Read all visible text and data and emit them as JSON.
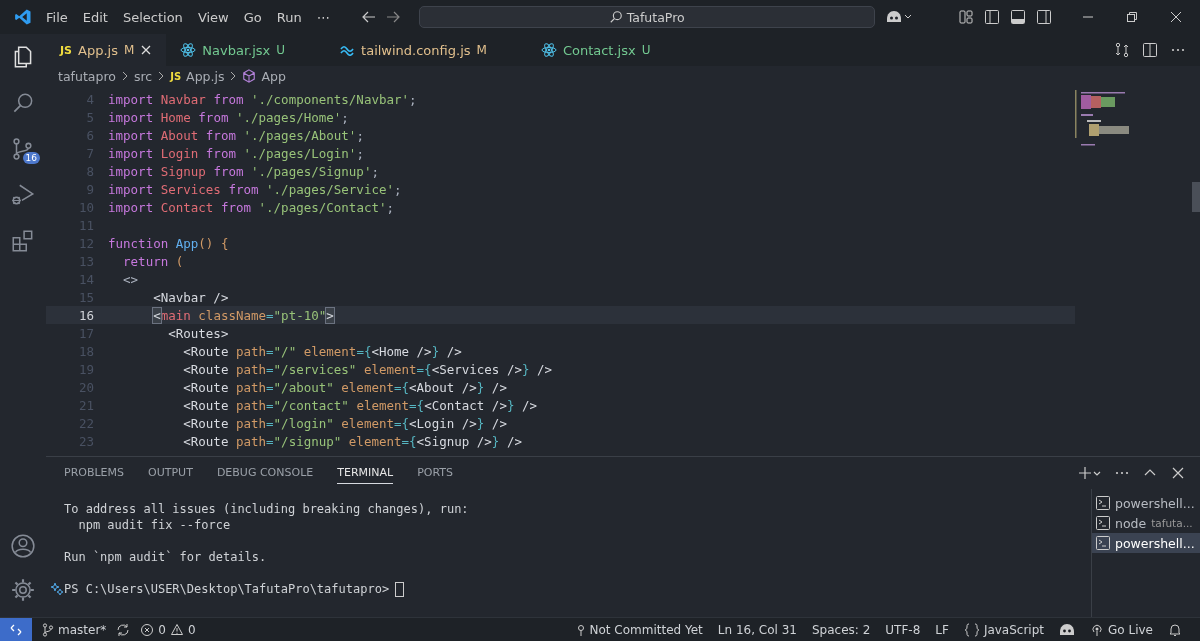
{
  "title_bar": {
    "menu": [
      "File",
      "Edit",
      "Selection",
      "View",
      "Go",
      "Run",
      "⋯"
    ],
    "search": {
      "value": "TafutaPro"
    }
  },
  "activity_bar": {
    "items": [
      {
        "kind": "explorer",
        "selected": true
      },
      {
        "kind": "search",
        "selected": false
      },
      {
        "kind": "source-control",
        "selected": false,
        "badge": "16"
      },
      {
        "kind": "run",
        "selected": false
      },
      {
        "kind": "extensions",
        "selected": false
      }
    ]
  },
  "tabs": [
    {
      "kind": "script",
      "type_label": "JS",
      "label": "App.js",
      "color": "#e2c08d",
      "badge": "M",
      "selected": true
    },
    {
      "kind": "component",
      "label": "Navbar.jsx",
      "color": "#73c991",
      "badge": "U",
      "selected": false
    },
    {
      "kind": "config",
      "label": "tailwind.config.js",
      "color": "#e2c08d",
      "badge": "M",
      "selected": false
    },
    {
      "kind": "component",
      "label": "Contact.jsx",
      "color": "#73c991",
      "badge": "U",
      "selected": false
    }
  ],
  "breadcrumbs": [
    {
      "kind": "folder",
      "text": "tafutapro"
    },
    {
      "kind": "folder",
      "text": "src"
    },
    {
      "kind": "file",
      "type_label": "JS",
      "text": "App.js"
    },
    {
      "kind": "symbol",
      "text": "App"
    }
  ],
  "editor": {
    "lines": [
      {
        "number": "4",
        "current": false,
        "tokens": [
          {
            "kind": "kw",
            "text": "import "
          },
          {
            "kind": "var",
            "text": "Navbar "
          },
          {
            "kind": "kw",
            "text": "from "
          },
          {
            "kind": "str",
            "text": "'./components/Navbar'"
          },
          {
            "kind": "punct",
            "text": ";"
          }
        ]
      },
      {
        "number": "5",
        "current": false,
        "tokens": [
          {
            "kind": "kw",
            "text": "import "
          },
          {
            "kind": "var",
            "text": "Home "
          },
          {
            "kind": "kw",
            "text": "from "
          },
          {
            "kind": "str",
            "text": "'./pages/Home'"
          },
          {
            "kind": "punct",
            "text": ";"
          }
        ]
      },
      {
        "number": "6",
        "current": false,
        "tokens": [
          {
            "kind": "kw",
            "text": "import "
          },
          {
            "kind": "var",
            "text": "About "
          },
          {
            "kind": "kw",
            "text": "from "
          },
          {
            "kind": "str",
            "text": "'./pages/About'"
          },
          {
            "kind": "punct",
            "text": ";"
          }
        ]
      },
      {
        "number": "7",
        "current": false,
        "tokens": [
          {
            "kind": "kw",
            "text": "import "
          },
          {
            "kind": "var",
            "text": "Login "
          },
          {
            "kind": "kw",
            "text": "from "
          },
          {
            "kind": "str",
            "text": "'./pages/Login'"
          },
          {
            "kind": "punct",
            "text": ";"
          }
        ]
      },
      {
        "number": "8",
        "current": false,
        "tokens": [
          {
            "kind": "kw",
            "text": "import "
          },
          {
            "kind": "var",
            "text": "Signup "
          },
          {
            "kind": "kw",
            "text": "from "
          },
          {
            "kind": "str",
            "text": "'./pages/Signup'"
          },
          {
            "kind": "punct",
            "text": ";"
          }
        ]
      },
      {
        "number": "9",
        "current": false,
        "tokens": [
          {
            "kind": "kw",
            "text": "import "
          },
          {
            "kind": "var",
            "text": "Services "
          },
          {
            "kind": "kw",
            "text": "from "
          },
          {
            "kind": "str",
            "text": "'./pages/Service'"
          },
          {
            "kind": "punct",
            "text": ";"
          }
        ]
      },
      {
        "number": "10",
        "current": false,
        "tokens": [
          {
            "kind": "kw",
            "text": "import "
          },
          {
            "kind": "var",
            "text": "Contact "
          },
          {
            "kind": "kw",
            "text": "from "
          },
          {
            "kind": "str",
            "text": "'./pages/Contact'"
          },
          {
            "kind": "punct",
            "text": ";"
          }
        ]
      },
      {
        "number": "11",
        "current": false
      },
      {
        "number": "12",
        "current": false,
        "tokens": [
          {
            "kind": "kw",
            "text": "function "
          },
          {
            "kind": "fn",
            "text": "App"
          },
          {
            "kind": "paren",
            "text": "() {"
          }
        ]
      },
      {
        "number": "13",
        "current": false,
        "tokens": [
          {
            "kind": "kw",
            "text": "  return "
          },
          {
            "kind": "paren",
            "text": "("
          }
        ]
      },
      {
        "number": "14",
        "current": false,
        "tokens": [
          {
            "kind": "punct",
            "text": "  <>"
          }
        ]
      },
      {
        "number": "15",
        "current": false,
        "tokens": [
          {
            "kind": "tag",
            "text": "      <Navbar />"
          }
        ]
      },
      {
        "number": "16",
        "current": true,
        "tokens": [
          {
            "kind": "match",
            "text": "      <"
          },
          {
            "kind": "var",
            "text": "main "
          },
          {
            "kind": "attr",
            "text": "className"
          },
          {
            "kind": "brace",
            "text": "="
          },
          {
            "kind": "str",
            "text": "\"pt-10\""
          },
          {
            "kind": "match",
            "text": ">"
          }
        ]
      },
      {
        "number": "17",
        "current": false,
        "tokens": [
          {
            "kind": "tag",
            "text": "        <Routes>"
          }
        ]
      },
      {
        "number": "18",
        "current": false,
        "tokens": [
          {
            "kind": "tag",
            "text": "          <Route "
          },
          {
            "kind": "attr",
            "text": "path"
          },
          {
            "kind": "brace",
            "text": "="
          },
          {
            "kind": "str",
            "text": "\"/\" "
          },
          {
            "kind": "attr",
            "text": "element"
          },
          {
            "kind": "brace",
            "text": "={"
          },
          {
            "kind": "tag",
            "text": "<Home />"
          },
          {
            "kind": "brace",
            "text": "}"
          },
          {
            "kind": "tag",
            "text": " />"
          }
        ]
      },
      {
        "number": "19",
        "current": false,
        "tokens": [
          {
            "kind": "tag",
            "text": "          <Route "
          },
          {
            "kind": "attr",
            "text": "path"
          },
          {
            "kind": "brace",
            "text": "="
          },
          {
            "kind": "str",
            "text": "\"/services\" "
          },
          {
            "kind": "attr",
            "text": "element"
          },
          {
            "kind": "brace",
            "text": "={"
          },
          {
            "kind": "tag",
            "text": "<Services />"
          },
          {
            "kind": "brace",
            "text": "}"
          },
          {
            "kind": "tag",
            "text": " />"
          }
        ]
      },
      {
        "number": "20",
        "current": false,
        "tokens": [
          {
            "kind": "tag",
            "text": "          <Route "
          },
          {
            "kind": "attr",
            "text": "path"
          },
          {
            "kind": "brace",
            "text": "="
          },
          {
            "kind": "str",
            "text": "\"/about\" "
          },
          {
            "kind": "attr",
            "text": "element"
          },
          {
            "kind": "brace",
            "text": "={"
          },
          {
            "kind": "tag",
            "text": "<About />"
          },
          {
            "kind": "brace",
            "text": "}"
          },
          {
            "kind": "tag",
            "text": " />"
          }
        ]
      },
      {
        "number": "21",
        "current": false,
        "tokens": [
          {
            "kind": "tag",
            "text": "          <Route "
          },
          {
            "kind": "attr",
            "text": "path"
          },
          {
            "kind": "brace",
            "text": "="
          },
          {
            "kind": "str",
            "text": "\"/contact\" "
          },
          {
            "kind": "attr",
            "text": "element"
          },
          {
            "kind": "brace",
            "text": "={"
          },
          {
            "kind": "tag",
            "text": "<Contact />"
          },
          {
            "kind": "brace",
            "text": "}"
          },
          {
            "kind": "tag",
            "text": " />"
          }
        ]
      },
      {
        "number": "22",
        "current": false,
        "tokens": [
          {
            "kind": "tag",
            "text": "          <Route "
          },
          {
            "kind": "attr",
            "text": "path"
          },
          {
            "kind": "brace",
            "text": "="
          },
          {
            "kind": "str",
            "text": "\"/login\" "
          },
          {
            "kind": "attr",
            "text": "element"
          },
          {
            "kind": "brace",
            "text": "={"
          },
          {
            "kind": "tag",
            "text": "<Login />"
          },
          {
            "kind": "brace",
            "text": "}"
          },
          {
            "kind": "tag",
            "text": " />"
          }
        ]
      },
      {
        "number": "23",
        "current": false,
        "tokens": [
          {
            "kind": "tag",
            "text": "          <Route "
          },
          {
            "kind": "attr",
            "text": "path"
          },
          {
            "kind": "brace",
            "text": "="
          },
          {
            "kind": "str",
            "text": "\"/signup\" "
          },
          {
            "kind": "attr",
            "text": "element"
          },
          {
            "kind": "brace",
            "text": "={"
          },
          {
            "kind": "tag",
            "text": "<Signup />"
          },
          {
            "kind": "brace",
            "text": "}"
          },
          {
            "kind": "tag",
            "text": " />"
          }
        ]
      }
    ]
  },
  "panel": {
    "tabs": [
      {
        "label": "PROBLEMS",
        "selected": false
      },
      {
        "label": "OUTPUT",
        "selected": false
      },
      {
        "label": "DEBUG CONSOLE",
        "selected": false
      },
      {
        "label": "TERMINAL",
        "selected": true
      },
      {
        "label": "PORTS",
        "selected": false
      }
    ],
    "terminal_blocks": [
      [
        "To address all issues (including breaking changes), run:",
        "  npm audit fix --force"
      ],
      [
        "Run `npm audit` for details."
      ]
    ],
    "prompt": "PS C:\\Users\\USER\\Desktop\\TafutaPro\\tafutapro>",
    "terminals": [
      {
        "name": "powershell...",
        "selected": false
      },
      {
        "name": "node",
        "detail": "tafuta...",
        "selected": false
      },
      {
        "name": "powershell...",
        "selected": true
      }
    ]
  },
  "status_bar": {
    "branch": "master*",
    "errors": "0",
    "warnings": "0",
    "blame": "Not Committed Yet",
    "position": "Ln 16, Col 31",
    "spaces": "Spaces: 2",
    "encoding": "UTF-8",
    "eol": "LF",
    "language": "JavaScript",
    "live": "Go Live"
  }
}
